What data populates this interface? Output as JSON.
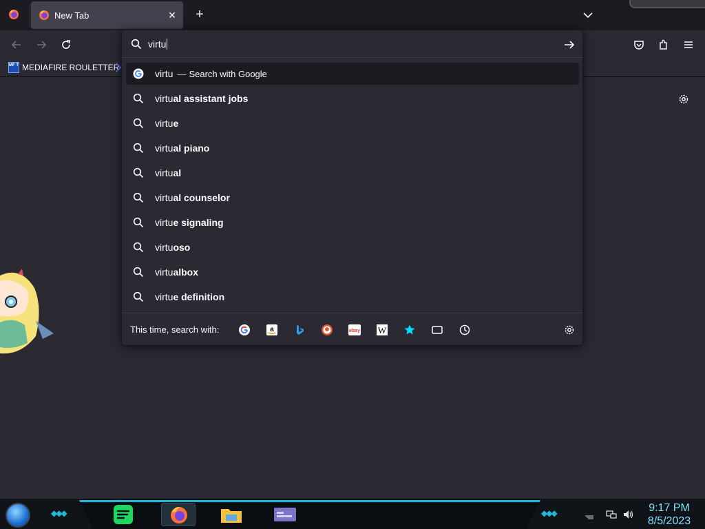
{
  "tabstrip": {
    "tab_title": "New Tab",
    "close_glyph": "✕",
    "new_tab_glyph": "+"
  },
  "bookmarks": {
    "items": [
      {
        "label": "MEDIAFIRE ROULETTER",
        "icon_text": "MF T"
      }
    ]
  },
  "urlbar": {
    "typed_text": "virtu",
    "first_result": {
      "text": "virtu",
      "separator": "—",
      "action": "Search with Google"
    },
    "suggestions": [
      {
        "prefix": "virtu",
        "completion": "al assistant jobs"
      },
      {
        "prefix": "virtu",
        "completion": "e"
      },
      {
        "prefix": "virtu",
        "completion": "al piano"
      },
      {
        "prefix": "virtu",
        "completion": "al"
      },
      {
        "prefix": "virtu",
        "completion": "al counselor"
      },
      {
        "prefix": "virtu",
        "completion": "e signaling"
      },
      {
        "prefix": "virtu",
        "completion": "oso"
      },
      {
        "prefix": "virtu",
        "completion": "albox"
      },
      {
        "prefix": "virtu",
        "completion": "e definition"
      }
    ],
    "oneoff_label": "This time, search with:",
    "engines": [
      "google-icon",
      "amazon-icon",
      "bing-icon",
      "duckduckgo-icon",
      "ebay-icon",
      "wikipedia-icon",
      "bookmarks-star-icon",
      "tabs-icon",
      "history-icon"
    ]
  },
  "taskbar": {
    "time": "9:17 PM",
    "date": "8/5/2023"
  },
  "colors": {
    "toolbar_bg": "#2b2a33",
    "tabstrip_bg": "#1c1b22",
    "selected_tab": "#42414d",
    "taskbar_accent": "#1fb9d6",
    "clock_color": "#7fe0ff"
  }
}
